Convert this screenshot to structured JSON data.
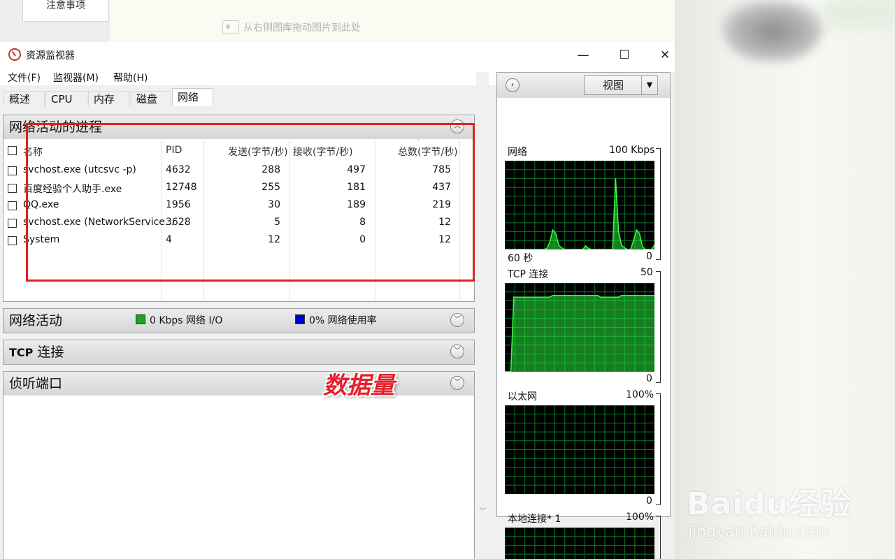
{
  "background": {
    "button_label": "注意事项",
    "drop_hint": "从右侧图库拖动图片到此处"
  },
  "window": {
    "title": "资源监视器",
    "controls": {
      "minimize": "—",
      "maximize": "☐",
      "close": "✕"
    }
  },
  "menu": [
    "文件(F)",
    "监视器(M)",
    "帮助(H)"
  ],
  "tabs": [
    {
      "label": "概述"
    },
    {
      "label": "CPU"
    },
    {
      "label": "内存"
    },
    {
      "label": "磁盘"
    },
    {
      "label": "网络",
      "active": true
    }
  ],
  "process_panel": {
    "title": "网络活动的进程",
    "columns": [
      "名称",
      "PID",
      "发送(字节/秒)",
      "接收(字节/秒)",
      "总数(字节/秒)"
    ],
    "rows": [
      [
        "svchost.exe (utcsvc -p)",
        "4632",
        "288",
        "497",
        "785"
      ],
      [
        "百度经验个人助手.exe",
        "12748",
        "255",
        "181",
        "437"
      ],
      [
        "QQ.exe",
        "1956",
        "30",
        "189",
        "219"
      ],
      [
        "svchost.exe (NetworkService...",
        "3628",
        "5",
        "8",
        "12"
      ],
      [
        "System",
        "4",
        "12",
        "0",
        "12"
      ]
    ]
  },
  "network_activity": {
    "title": "网络活动",
    "io_text": "0 Kbps 网络 I/O",
    "usage_text": "0% 网络使用率",
    "io_color": "#1aa51a",
    "usage_color": "#0000cc"
  },
  "tcp_panel": {
    "title_bold": "TCP",
    "title_rest": " 连接"
  },
  "listen_panel": {
    "title": "侦听端口"
  },
  "graphs": {
    "view_label": "视图",
    "network": {
      "label": "网络",
      "max": "100 Kbps",
      "time": "60 秒",
      "min": "0",
      "values": [
        0,
        0,
        0,
        0,
        0,
        0,
        0,
        0,
        0,
        0,
        0,
        0,
        0,
        0,
        1,
        8,
        22,
        18,
        5,
        2,
        0,
        0,
        0,
        0,
        0,
        0,
        0,
        4,
        1,
        0,
        0,
        0,
        0,
        0,
        0,
        0,
        0,
        80,
        20,
        5,
        2,
        0,
        0,
        10,
        22,
        18,
        3,
        0,
        0,
        0,
        5
      ]
    },
    "tcp": {
      "label": "TCP 连接",
      "max": "50",
      "min": "0",
      "values": [
        0,
        0,
        0,
        42,
        42,
        42,
        42,
        42,
        42,
        42,
        42,
        42,
        42,
        42,
        42,
        42,
        43,
        43,
        43,
        43,
        43,
        43,
        43,
        43,
        43,
        43,
        43,
        43,
        43,
        43,
        43,
        43,
        42,
        42,
        42,
        42,
        42,
        42,
        42,
        43,
        43,
        43,
        43,
        43,
        43,
        43,
        43,
        43,
        43,
        43,
        43
      ]
    },
    "ethernet": {
      "label": "以太网",
      "max": "100%",
      "min": "0"
    },
    "local": {
      "label": "本地连接* 1",
      "max": "100%"
    }
  },
  "annotation": "数据量",
  "watermark": {
    "main": "Baidu经验",
    "sub": "jingyan.baidu.com"
  }
}
